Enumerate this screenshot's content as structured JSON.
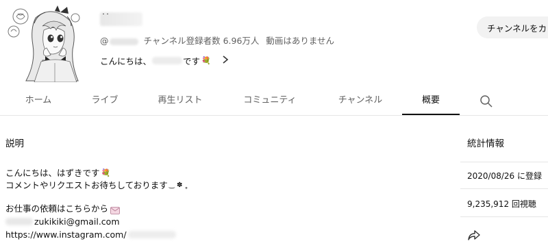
{
  "channel": {
    "name_mark": "˙˙",
    "handle_prefix": "@",
    "subscribers": "チャンネル登録者数 6.96万人",
    "videos_status": "動画はありません",
    "tagline_prefix": "こんにちは、",
    "tagline_suffix": "です",
    "tagline_emoji": "💐"
  },
  "customize_button": "チャンネルをカ",
  "tabs": [
    {
      "label": "ホーム"
    },
    {
      "label": "ライブ"
    },
    {
      "label": "再生リスト"
    },
    {
      "label": "コミュニティ"
    },
    {
      "label": "チャンネル"
    },
    {
      "label": "概要"
    }
  ],
  "active_tab": "概要",
  "description": {
    "title": "説明",
    "line1": "こんにちは、はずきです",
    "line1_emoji": "💐",
    "line2": "コメントやリクエストお待ちしております",
    "line2_decoration": "‿ ✽ ˳",
    "line3": "お仕事の依頼はこちらから",
    "email_visible": "zukikiki@gmail.com",
    "url_visible": "https://www.instagram.com/"
  },
  "stats": {
    "title": "統計情報",
    "joined": "2020/08/26 に登録",
    "views": "9,235,912 回視聴"
  },
  "colors": {
    "text_primary": "#0f0f0f",
    "text_secondary": "#606060",
    "divider": "#e5e5e5",
    "button_bg": "#f2f2f2"
  }
}
